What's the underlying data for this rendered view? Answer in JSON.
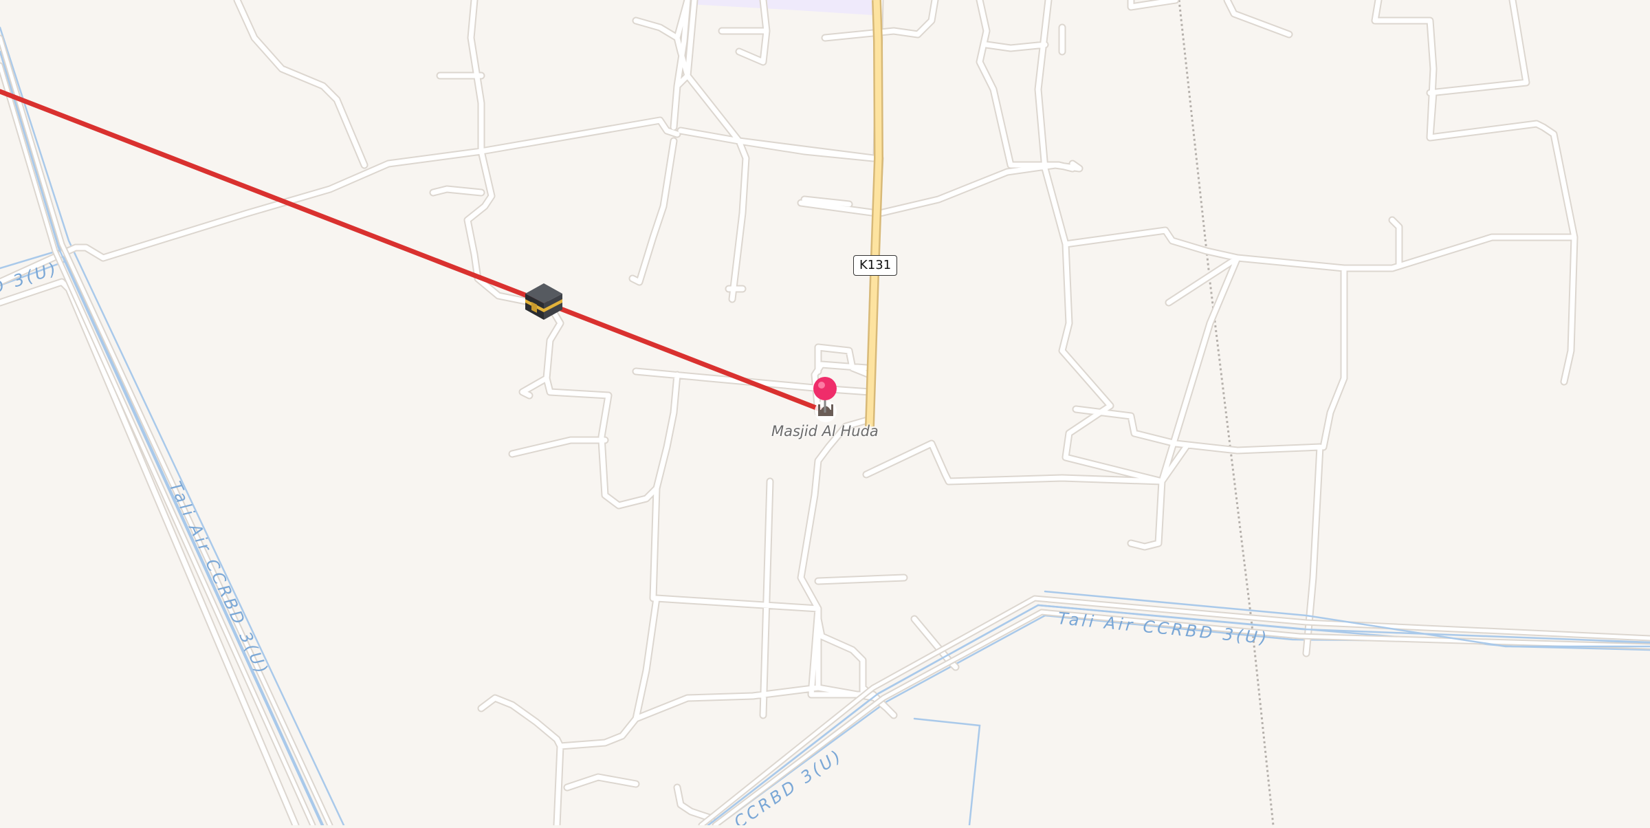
{
  "map": {
    "place_label": "Masjid Al Huda",
    "route_shield": "K131",
    "canal_labels": [
      "Tali Air CCRBD 3(U)",
      "Tali Air CCRBD 3(U)",
      "D 3(U)",
      "CCRBD 3(U)"
    ],
    "icons": {
      "destination": "kaaba-icon",
      "origin_pin": "location-pin-icon",
      "poi": "mosque-icon"
    },
    "colors": {
      "background": "#f8f5f1",
      "road": "#ffffff",
      "road_casing": "#dcd6cf",
      "primary_road": "#fde3a0",
      "canal": "#a9c9ea",
      "canal_text": "#7aa7d6",
      "qibla_line": "#d9312f",
      "pin": "#ef2d6a",
      "residential_area": "#efeafb",
      "rail": "#b5b0ab"
    }
  }
}
